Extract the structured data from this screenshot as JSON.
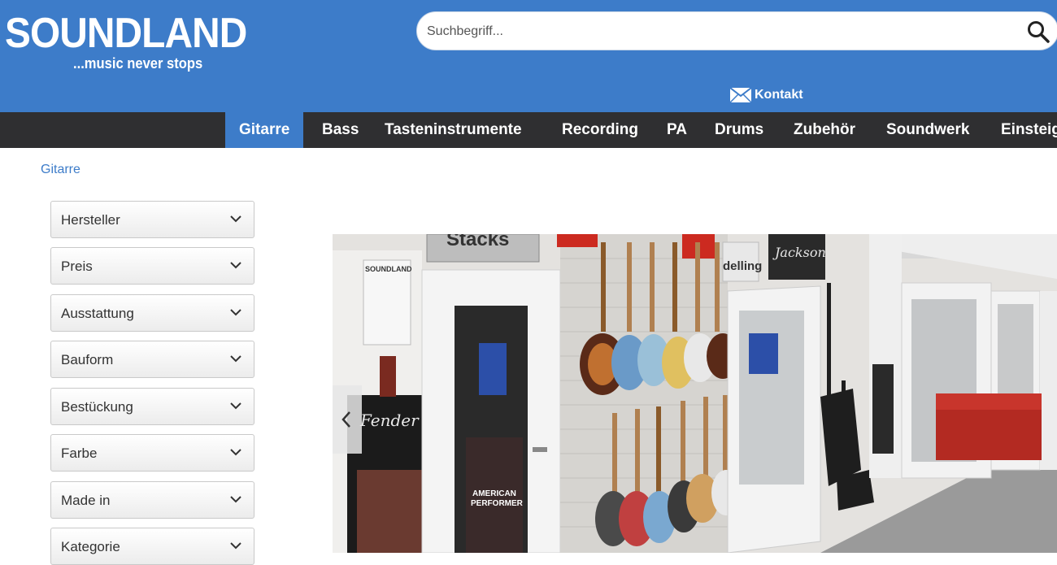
{
  "header": {
    "logo_main": "SOUNDLAND",
    "logo_sub": "...music never stops",
    "search_placeholder": "Suchbegriff...",
    "kontakt_label": "Kontakt"
  },
  "nav": {
    "items": [
      {
        "label": "Gitarre",
        "active": true
      },
      {
        "label": "Bass"
      },
      {
        "label": "Tasteninstrumente"
      },
      {
        "label": "Recording"
      },
      {
        "label": "PA"
      },
      {
        "label": "Drums"
      },
      {
        "label": "Zubehör"
      },
      {
        "label": "Soundwerk"
      },
      {
        "label": "Einsteig"
      }
    ]
  },
  "breadcrumb": "Gitarre",
  "filters": [
    {
      "label": "Hersteller"
    },
    {
      "label": "Preis"
    },
    {
      "label": "Ausstattung"
    },
    {
      "label": "Bauform"
    },
    {
      "label": "Bestückung"
    },
    {
      "label": "Farbe"
    },
    {
      "label": "Made in"
    },
    {
      "label": "Kategorie"
    }
  ],
  "hero": {
    "signs": {
      "stacks": "Stacks",
      "soundland": "SOUNDLAND",
      "fender": "Fender",
      "jackson": "Jackson",
      "modelling": "delling",
      "american": "AMERICAN",
      "performer": "PERFORMER"
    }
  },
  "colors": {
    "brand_blue": "#3d7cc9",
    "nav_dark": "#2f2f31"
  }
}
